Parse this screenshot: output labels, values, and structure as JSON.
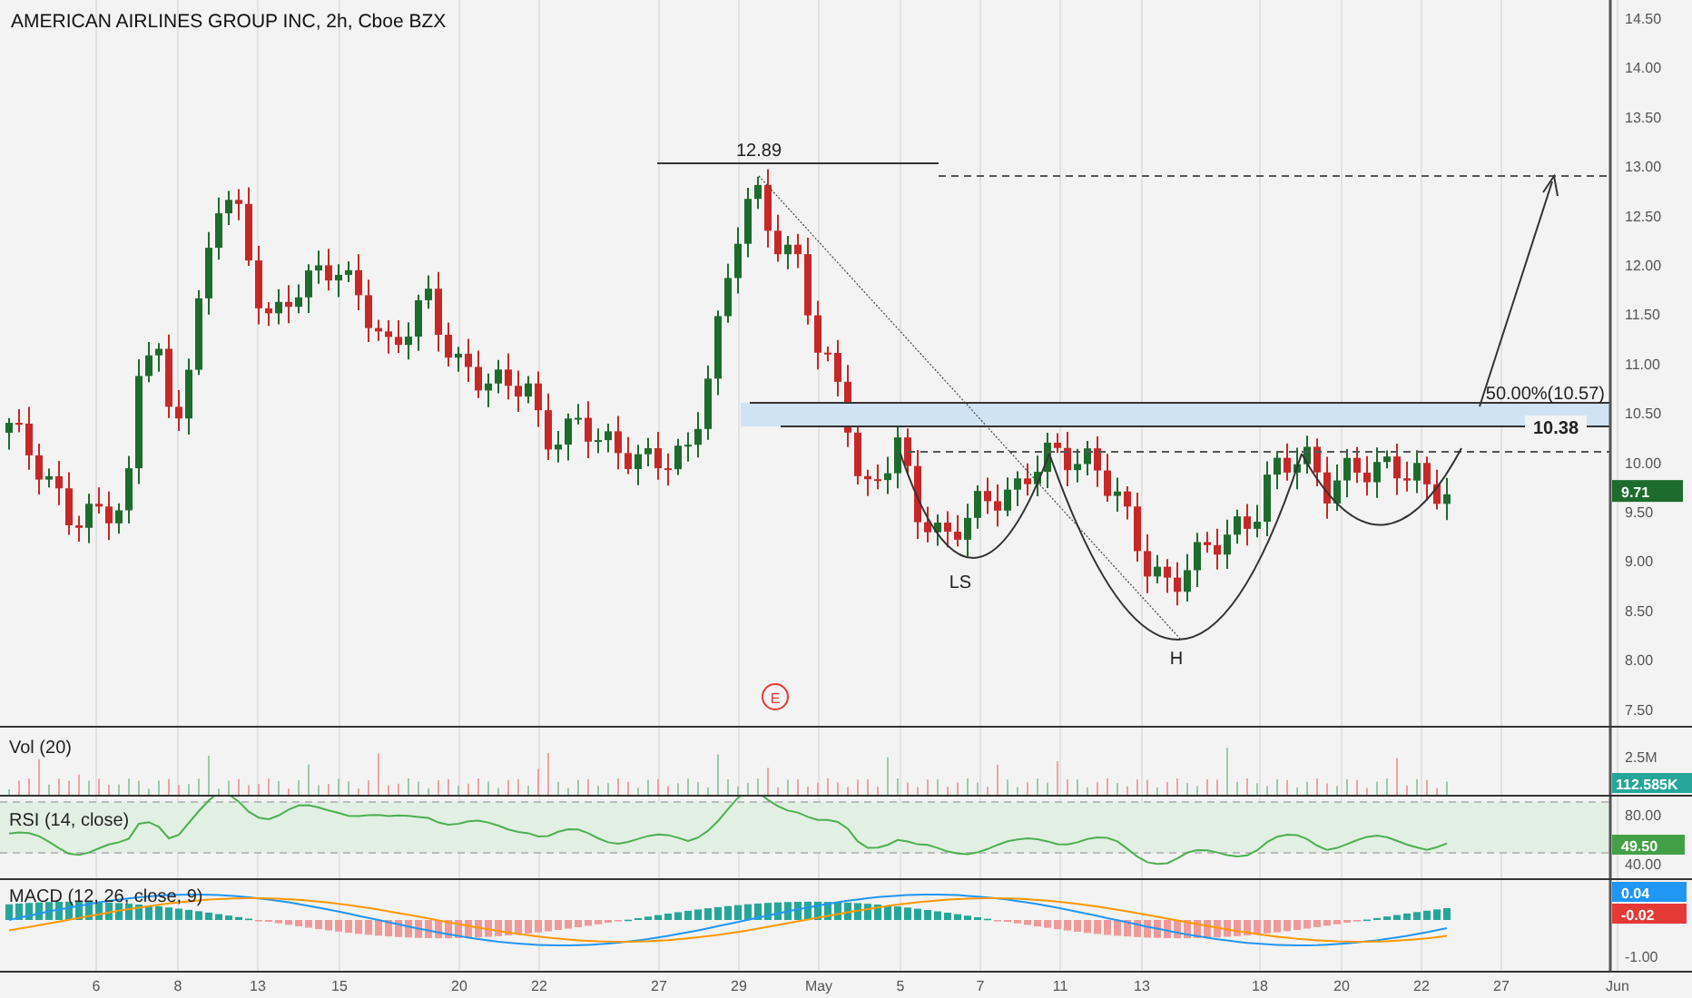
{
  "header": {
    "title": "AMERICAN AIRLINES GROUP INC, 2h, Cboe BZX"
  },
  "price_pane": {
    "axis_labels": [
      "14.50",
      "14.00",
      "13.50",
      "13.00",
      "12.50",
      "12.00",
      "11.50",
      "11.00",
      "10.50",
      "10.00",
      "9.50",
      "9.00",
      "8.50",
      "8.00",
      "7.50"
    ],
    "last_price": "9.71",
    "annotations": {
      "peak": "12.89",
      "fib": "50.00%(10.57)",
      "support": "10.38",
      "left_shoulder": "LS",
      "head": "H",
      "earnings": "E"
    }
  },
  "volume_pane": {
    "title": "Vol (20)",
    "axis_label": "2.5M",
    "last_value": "112.585K"
  },
  "rsi_pane": {
    "title": "RSI (14, close)",
    "axis_labels": [
      "80.00",
      "40.00"
    ],
    "last_value": "49.50"
  },
  "macd_pane": {
    "title": "MACD (12, 26, close, 9)",
    "macd_value": "0.04",
    "signal_value": "-0.02",
    "axis_label": "-1.00"
  },
  "time_axis": {
    "labels": [
      "6",
      "8",
      "13",
      "15",
      "20",
      "22",
      "27",
      "29",
      "May",
      "5",
      "7",
      "11",
      "13",
      "18",
      "20",
      "22",
      "27",
      "Jun"
    ]
  }
}
